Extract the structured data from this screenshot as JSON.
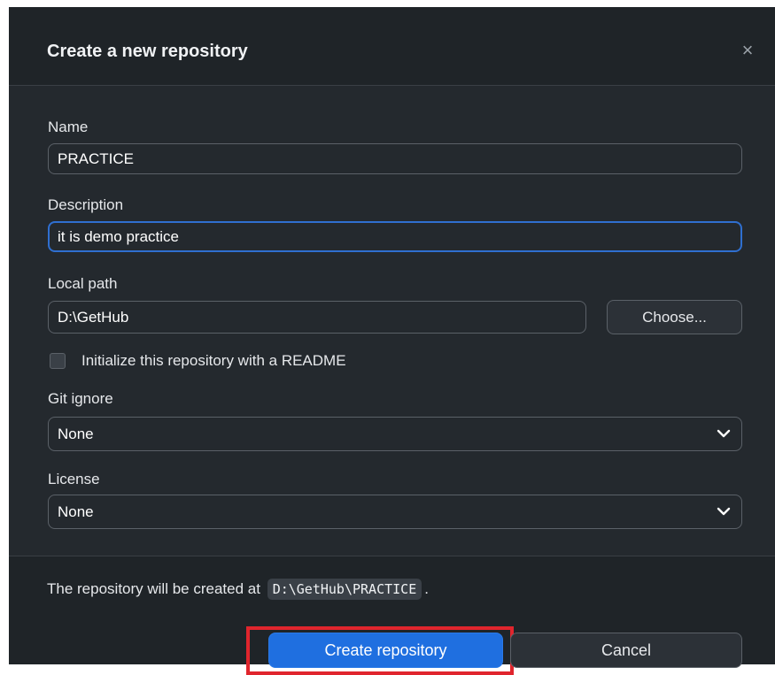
{
  "dialog": {
    "title": "Create a new repository",
    "close_glyph": "×"
  },
  "form": {
    "name": {
      "label": "Name",
      "value": "PRACTICE"
    },
    "description": {
      "label": "Description",
      "value": "it is demo practice"
    },
    "local_path": {
      "label": "Local path",
      "value": "D:\\GetHub",
      "choose_label": "Choose..."
    },
    "readme": {
      "label": "Initialize this repository with a README",
      "checked": false
    },
    "gitignore": {
      "label": "Git ignore",
      "selected": "None"
    },
    "license": {
      "label": "License",
      "selected": "None"
    }
  },
  "footer": {
    "message_prefix": "The repository will be created at",
    "path": "D:\\GetHub\\PRACTICE",
    "message_suffix": ".",
    "create_label": "Create repository",
    "cancel_label": "Cancel"
  },
  "icons": {
    "close": "close-icon",
    "select_chevron": "chevron-down-icon"
  },
  "colors": {
    "dialog_bg": "#24292e",
    "header_bg": "#1f2428",
    "primary_button": "#1f6fe0",
    "focus_border": "#2f6fd0",
    "highlight_box": "#e0252d"
  }
}
